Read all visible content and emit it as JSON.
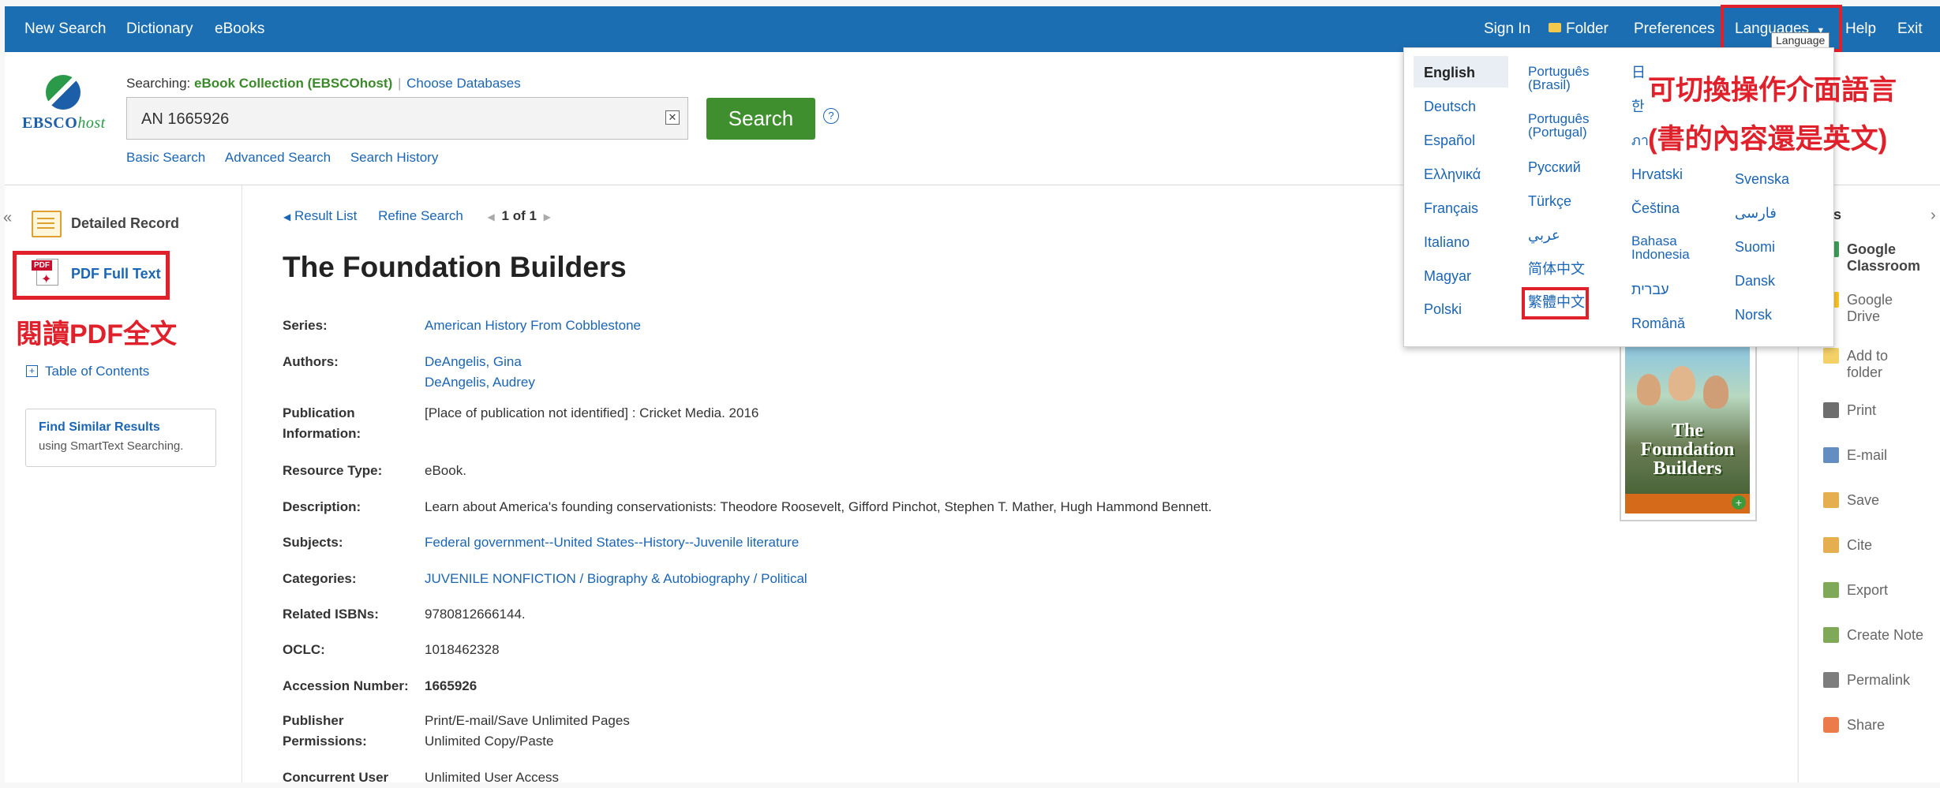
{
  "topnav": {
    "left": [
      "New Search",
      "Dictionary",
      "eBooks"
    ],
    "sign_in": "Sign In",
    "folder": "Folder",
    "preferences": "Preferences",
    "languages": "Languages",
    "languages_tooltip": "Language",
    "help": "Help",
    "exit": "Exit"
  },
  "logo": {
    "ebsco": "EBSCO",
    "host": "host"
  },
  "searching": {
    "prefix": "Searching:",
    "collection": "eBook Collection (EBSCOhost)",
    "choose": "Choose Databases"
  },
  "search": {
    "value": "AN 1665926",
    "button": "Search",
    "help": "?"
  },
  "search_links": [
    "Basic Search",
    "Advanced Search",
    "Search History"
  ],
  "sidebar": {
    "collapse": "«",
    "detailed_record": "Detailed Record",
    "pdf_full_text": "PDF Full Text",
    "pdf_badge": "PDF",
    "pdf_callout": "閱讀PDF全文",
    "toc": "Table of Contents",
    "find_similar_title": "Find Similar Results",
    "find_similar_sub": "using SmartText Searching."
  },
  "result_nav": {
    "result_list": "Result List",
    "refine": "Refine Search",
    "position": "1 of 1"
  },
  "record": {
    "title": "The Foundation Builders",
    "fields": [
      {
        "label": "Series:",
        "values": [
          "American History From Cobblestone"
        ],
        "link": true
      },
      {
        "label": "Authors:",
        "values": [
          "DeAngelis, Gina",
          "DeAngelis, Audrey"
        ],
        "link": true
      },
      {
        "label": "Publication\nInformation:",
        "values": [
          "[Place of publication not identified] : Cricket Media. 2016"
        ],
        "link": false
      },
      {
        "label": "Resource Type:",
        "values": [
          "eBook."
        ],
        "link": false
      },
      {
        "label": "Description:",
        "values": [
          "Learn about America's founding conservationists: Theodore Roosevelt, Gifford Pinchot, Stephen T. Mather, Hugh Hammond Bennett."
        ],
        "link": false
      },
      {
        "label": "Subjects:",
        "values": [
          "Federal government--United States--History--Juvenile literature"
        ],
        "link": true
      },
      {
        "label": "Categories:",
        "values": [
          "JUVENILE NONFICTION / Biography & Autobiography / Political"
        ],
        "link": true
      },
      {
        "label": "Related ISBNs:",
        "values": [
          "9780812666144."
        ],
        "link": false
      },
      {
        "label": "OCLC:",
        "values": [
          "1018462328"
        ],
        "link": false
      },
      {
        "label": "Accession Number:",
        "values": [
          "1665926"
        ],
        "link": false,
        "bold": true
      },
      {
        "label": "Publisher\nPermissions:",
        "values": [
          "Print/E-mail/Save Unlimited Pages",
          "Unlimited Copy/Paste"
        ],
        "link": false
      },
      {
        "label": "Concurrent User",
        "values": [
          "Unlimited User Access"
        ],
        "link": false
      }
    ]
  },
  "cover": {
    "title_line1": "The",
    "title_line2": "Foundation",
    "title_line3": "Builders"
  },
  "tools": {
    "header": "ools",
    "expand": "›",
    "items": [
      {
        "label": "Google Classroom",
        "bold": true,
        "icon": "google-classroom-icon"
      },
      {
        "label": "Google Drive",
        "icon": "google-drive-icon"
      },
      {
        "label": "Add to folder",
        "icon": "folder-icon"
      },
      {
        "label": "Print",
        "icon": "print-icon"
      },
      {
        "label": "E-mail",
        "icon": "email-icon"
      },
      {
        "label": "Save",
        "icon": "save-icon"
      },
      {
        "label": "Cite",
        "icon": "cite-icon"
      },
      {
        "label": "Export",
        "icon": "export-icon"
      },
      {
        "label": "Create Note",
        "icon": "note-icon"
      },
      {
        "label": "Permalink",
        "icon": "link-icon"
      },
      {
        "label": "Share",
        "icon": "share-icon"
      }
    ]
  },
  "languages": {
    "col1": [
      "English",
      "Deutsch",
      "Español",
      "Ελληνικά",
      "Français",
      "Italiano",
      "Magyar",
      "Polski"
    ],
    "col2": [
      "Português\n(Brasil)",
      "Português\n(Portugal)",
      "Русский",
      "Türkçe",
      "عربي",
      "简体中文",
      "繁體中文"
    ],
    "col3": [
      "日",
      "한",
      "ภา",
      "Hrvatski",
      "Čeština",
      "Bahasa\nIndonesia",
      "עברית",
      "Română"
    ],
    "col4": [
      "Svenska",
      "فارسی",
      "Suomi",
      "Dansk",
      "Norsk"
    ],
    "selected": "English",
    "callout_line1": "可切換操作介面語言",
    "callout_line2": "(書的內容還是英文)"
  },
  "colors": {
    "topbar": "#1c6eb2",
    "search_button": "#3f8f2f",
    "link": "#1a65b5",
    "annotation_red": "#e0202a"
  }
}
